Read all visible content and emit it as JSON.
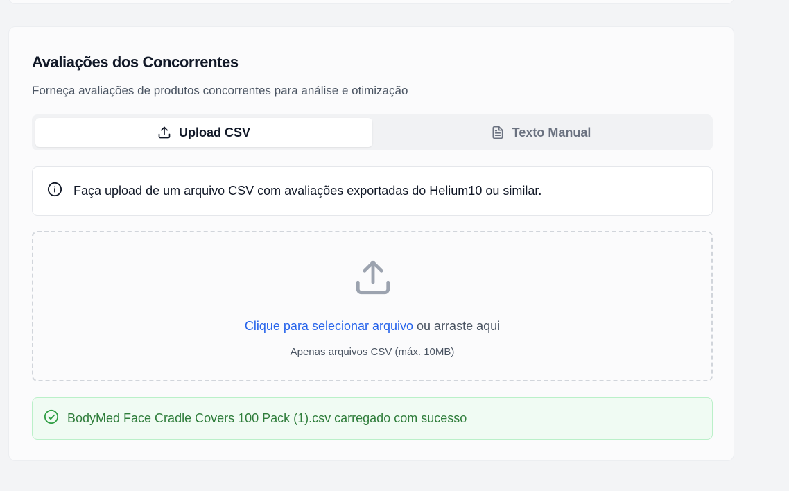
{
  "section": {
    "title": "Avaliações dos Concorrentes",
    "subtitle": "Forneça avaliações de produtos concorrentes para análise e otimização"
  },
  "tabs": [
    {
      "label": "Upload CSV",
      "icon": "upload-icon",
      "active": true
    },
    {
      "label": "Texto Manual",
      "icon": "file-text-icon",
      "active": false
    }
  ],
  "info": {
    "icon": "info-icon",
    "text": "Faça upload de um arquivo CSV com avaliações exportadas do Helium10 ou similar."
  },
  "dropzone": {
    "icon": "upload-icon",
    "link_text": "Clique para selecionar arquivo",
    "rest_text": " ou arraste aqui",
    "hint": "Apenas arquivos CSV (máx. 10MB)"
  },
  "success": {
    "icon": "check-circle-icon",
    "text": "BodyMed Face Cradle Covers 100 Pack (1).csv carregado com sucesso"
  },
  "colors": {
    "link": "#2563eb",
    "success_text": "#2f7d3b",
    "success_bg": "#f0fbf3",
    "success_border": "#bbf0c9"
  }
}
